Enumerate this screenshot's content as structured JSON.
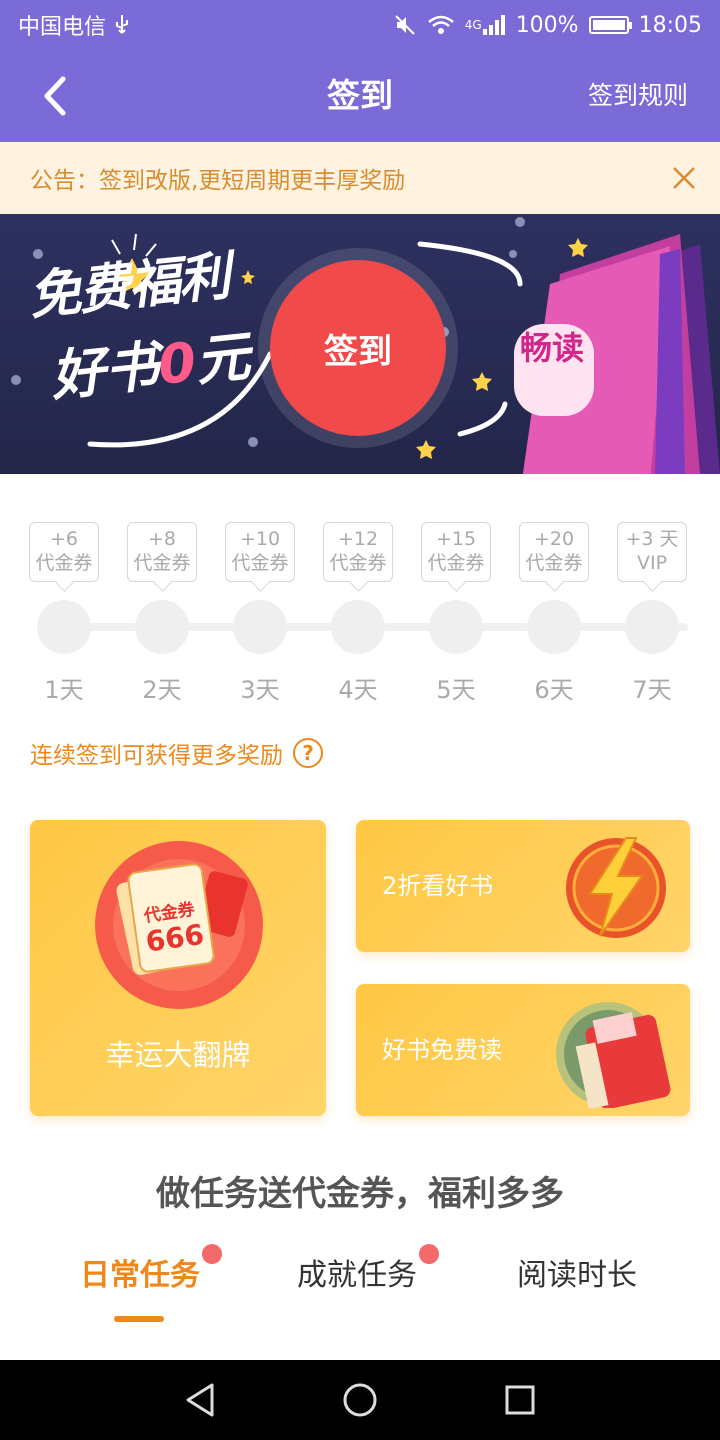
{
  "status_bar": {
    "carrier": "中国电信",
    "network": "4G",
    "battery": "100%",
    "time": "18:05",
    "battery_level": 1.0
  },
  "nav": {
    "title": "签到",
    "rules_label": "签到规则"
  },
  "notice": {
    "text": "公告：签到改版,更短周期更丰厚奖励"
  },
  "banner": {
    "slogan_line1": "免费福利",
    "slogan_line2_prefix": "好书",
    "slogan_line2_zero": "0",
    "slogan_line2_suffix": "元",
    "checkin_label": "签到",
    "book_text": "畅读"
  },
  "days": [
    {
      "reward_line1": "+6",
      "reward_line2": "代金券",
      "label": "1天"
    },
    {
      "reward_line1": "+8",
      "reward_line2": "代金券",
      "label": "2天"
    },
    {
      "reward_line1": "+10",
      "reward_line2": "代金券",
      "label": "3天"
    },
    {
      "reward_line1": "+12",
      "reward_line2": "代金券",
      "label": "4天"
    },
    {
      "reward_line1": "+15",
      "reward_line2": "代金券",
      "label": "5天"
    },
    {
      "reward_line1": "+20",
      "reward_line2": "代金券",
      "label": "6天"
    },
    {
      "reward_line1": "+3 天",
      "reward_line2": "VIP",
      "label": "7天"
    }
  ],
  "more_rewards_tip": "连续签到可获得更多奖励",
  "cards": {
    "lucky_flip": {
      "label": "幸运大翻牌",
      "coupon_text": "代金券",
      "coupon_number": "666"
    },
    "discount": {
      "label": "2折看好书"
    },
    "free_read": {
      "label": "好书免费读"
    }
  },
  "tasks": {
    "title": "做任务送代金券，福利多多",
    "tabs": [
      {
        "label": "日常任务",
        "active": true,
        "badge": true
      },
      {
        "label": "成就任务",
        "active": false,
        "badge": true
      },
      {
        "label": "阅读时长",
        "active": false,
        "badge": false
      }
    ]
  },
  "colors": {
    "header_purple": "#7b6bd6",
    "accent_orange": "#f0871b",
    "checkin_red": "#f04a4a",
    "notice_bg": "#fdf3e0",
    "card_yellow": "#ffc844"
  }
}
